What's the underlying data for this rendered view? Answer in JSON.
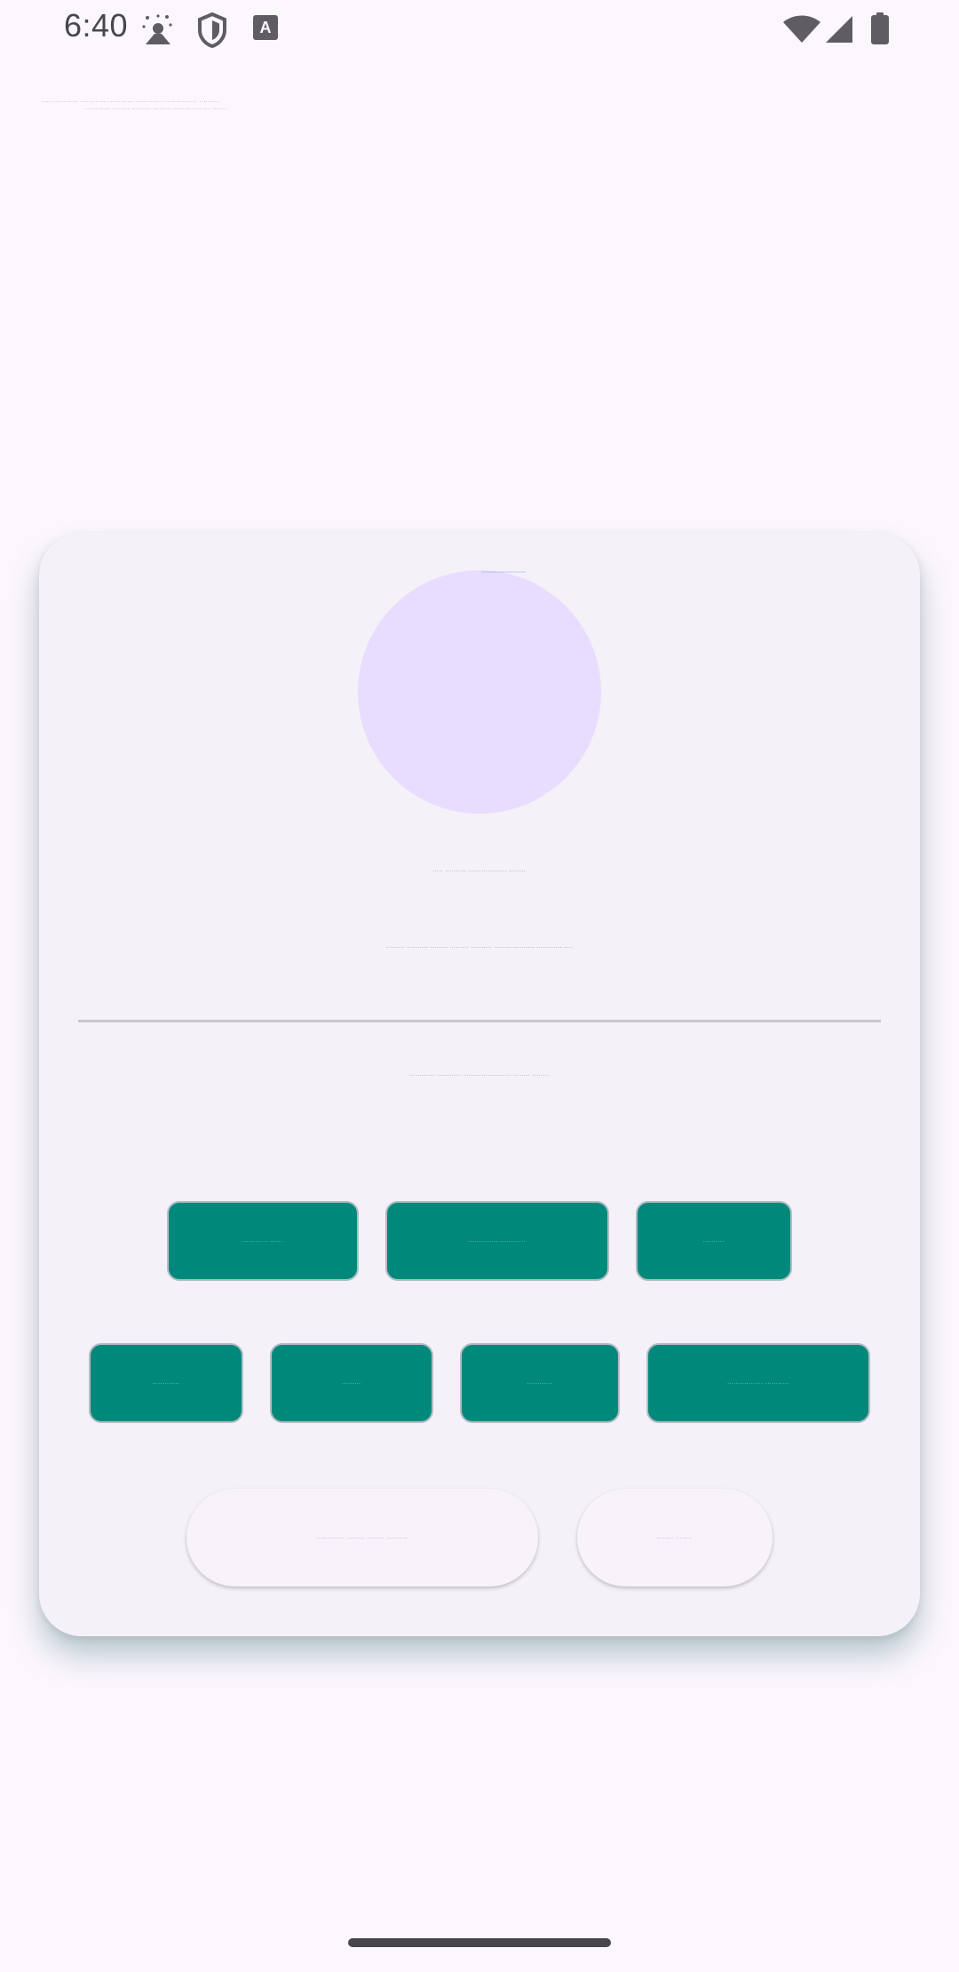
{
  "status_bar": {
    "time": "6:40",
    "icons": [
      "weather-icon",
      "shield-icon",
      "keyboard-a-icon",
      "wifi-icon",
      "signal-icon",
      "battery-icon"
    ]
  },
  "header": {
    "line1": "................. ............ ............ ............ ................ ..........",
    "line2": "............ ........ ......... ......... ........ ........ ......."
  },
  "profile": {
    "avatar_caption": "~~~~~~~~~~~~~~~~~",
    "name": "..... .......... .................. ........",
    "detail": "......... .......... ........ ......... .......... ........ .......... ............ ....",
    "status": "............ ............ ...................... ........ ........"
  },
  "actions": {
    "row1": [
      "............ ......",
      ".............. ............",
      ".........."
    ],
    "row2": [
      ".............",
      ".........",
      "............",
      "................. ..........."
    ]
  },
  "pills": {
    "primary": "............. ......... ........ ..........",
    "secondary": "........ ........"
  },
  "colors": {
    "background": "#fcf7fd",
    "card": "#f4f1f8",
    "avatar": "#e9ddff",
    "button": "#00897b",
    "divider": "#cac6ce",
    "status_icons": "#5f5d63"
  }
}
